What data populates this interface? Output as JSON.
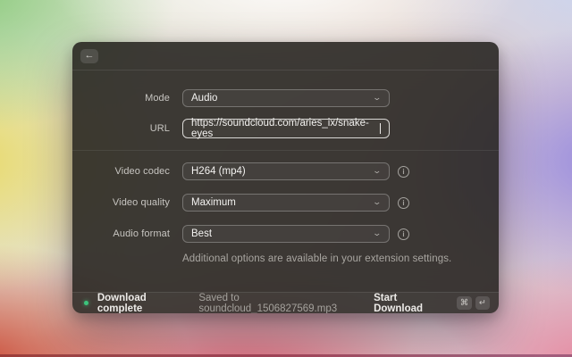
{
  "icons": {
    "back": "←",
    "chevron": "⌄",
    "info": "i"
  },
  "form": {
    "rows": [
      {
        "label": "Mode",
        "value": "Audio"
      },
      {
        "label": "URL",
        "value": "https://soundcloud.com/aries_ix/snake-eyes"
      },
      {
        "label": "Video codec",
        "value": "H264 (mp4)"
      },
      {
        "label": "Video quality",
        "value": "Maximum"
      },
      {
        "label": "Audio format",
        "value": "Best"
      }
    ],
    "note": "Additional options are available in your extension settings."
  },
  "status_bar": {
    "status": "Download complete",
    "detail": "Saved to soundcloud_1506827569.mp3",
    "action": "Start Download",
    "shortcut_keys": [
      "⌘",
      "↵"
    ]
  },
  "colors": {
    "status_dot": "#3cc47c",
    "dialog_bg": "rgba(31,29,26,0.86)"
  }
}
